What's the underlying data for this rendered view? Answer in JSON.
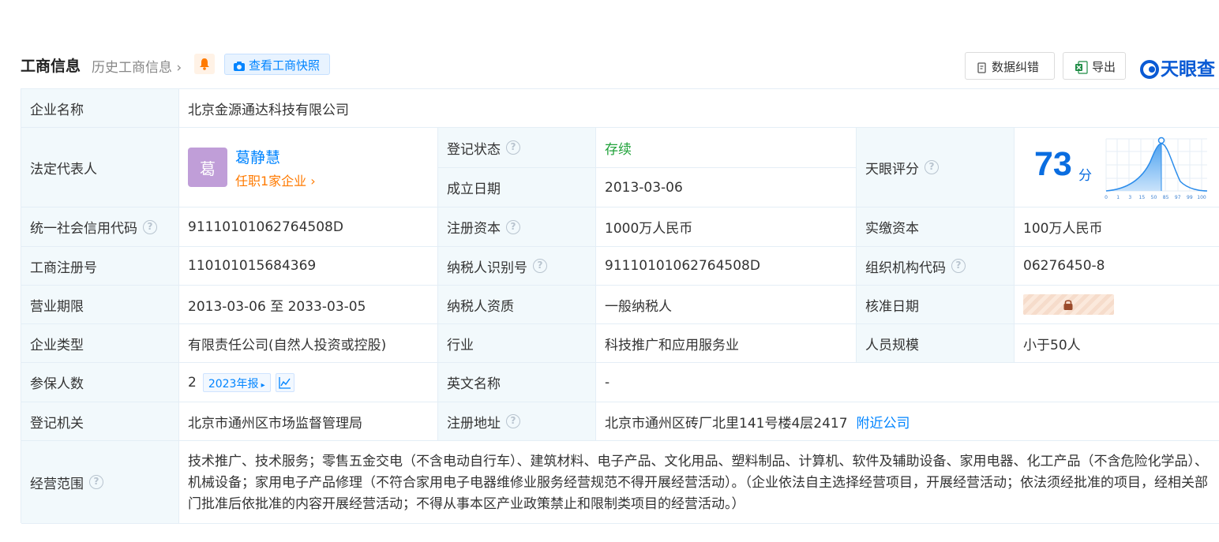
{
  "header": {
    "title": "工商信息",
    "history_link": "历史工商信息",
    "snapshot_button": "查看工商快照",
    "correct_button": "数据纠错",
    "export_button": "导出",
    "logo_text": "天眼查"
  },
  "labels": {
    "company_name": "企业名称",
    "legal_rep": "法定代表人",
    "reg_status": "登记状态",
    "found_date": "成立日期",
    "tianyan_score": "天眼评分",
    "credit_code": "统一社会信用代码",
    "reg_capital": "注册资本",
    "paid_capital": "实缴资本",
    "reg_number": "工商注册号",
    "taxpayer_id": "纳税人识别号",
    "org_code": "组织机构代码",
    "term": "营业期限",
    "taxpayer_type": "纳税人资质",
    "approve_date": "核准日期",
    "company_type": "企业类型",
    "industry": "行业",
    "staff_size": "人员规模",
    "insured": "参保人数",
    "english_name": "英文名称",
    "reg_authority": "登记机关",
    "reg_address": "注册地址",
    "business_scope": "经营范围"
  },
  "values": {
    "company_name": "北京金源通达科技有限公司",
    "legal_rep_avatar": "葛",
    "legal_rep_name": "葛静慧",
    "legal_rep_sub": "任职1家企业",
    "reg_status": "存续",
    "found_date": "2013-03-06",
    "score": "73",
    "score_unit": "分",
    "credit_code": "91110101062764508D",
    "reg_capital": "1000万人民币",
    "paid_capital": "100万人民币",
    "reg_number": "110101015684369",
    "taxpayer_id": "91110101062764508D",
    "org_code": "06276450-8",
    "term": "2013-03-06 至 2033-03-05",
    "taxpayer_type": "一般纳税人",
    "company_type": "有限责任公司(自然人投资或控股)",
    "industry": "科技推广和应用服务业",
    "staff_size": "小于50人",
    "insured": "2",
    "insured_year": "2023年报",
    "english_name": "-",
    "reg_authority": "北京市通州区市场监督管理局",
    "reg_address": "北京市通州区砖厂北里141号楼4层2417",
    "nearby_link": "附近公司",
    "business_scope": "技术推广、技术服务；零售五金交电（不含电动自行车）、建筑材料、电子产品、文化用品、塑料制品、计算机、软件及辅助设备、家用电器、化工产品（不含危险化学品）、机械设备；家用电子产品修理（不符合家用电子电器维修业服务经营规范不得开展经营活动）。（企业依法自主选择经营项目，开展经营活动；依法须经批准的项目，经相关部门批准后依批准的内容开展经营活动；不得从事本区产业政策禁止和限制类项目的经营活动。）"
  },
  "score_chart": {
    "ticks": [
      "0",
      "1",
      "3",
      "15",
      "50",
      "85",
      "97",
      "99",
      "100"
    ],
    "marker_value": 73
  },
  "colors": {
    "accent": "#0084ff",
    "label_bg": "#f2f9fc",
    "status_green": "#20a23a",
    "orange": "#ff7a00"
  }
}
